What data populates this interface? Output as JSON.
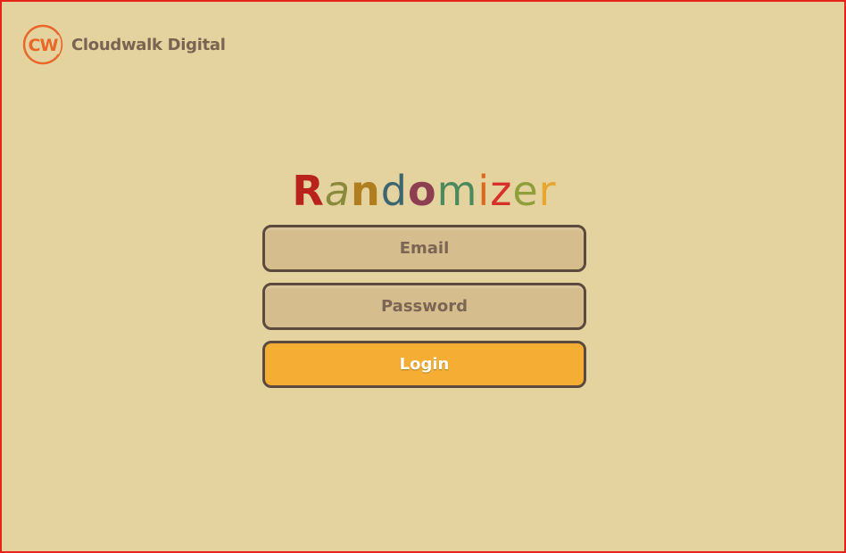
{
  "brand": {
    "name": "Cloudwalk Digital",
    "logo_icon": "cloudwalk-cw-logo-icon",
    "logo_text": "CW",
    "logo_color": "#e8672a"
  },
  "title": {
    "letters": [
      {
        "char": "R",
        "color": "#b8231c"
      },
      {
        "char": "a",
        "color": "#8a8a3c"
      },
      {
        "char": "n",
        "color": "#b07d1f"
      },
      {
        "char": "d",
        "color": "#3b6670"
      },
      {
        "char": "o",
        "color": "#8d3f52"
      },
      {
        "char": "m",
        "color": "#4c8a5e"
      },
      {
        "char": "i",
        "color": "#d9691f"
      },
      {
        "char": "z",
        "color": "#d8302b"
      },
      {
        "char": "e",
        "color": "#8fa03b"
      },
      {
        "char": "r",
        "color": "#e8a530"
      }
    ]
  },
  "form": {
    "email_placeholder": "Email",
    "password_placeholder": "Password",
    "login_label": "Login"
  },
  "colors": {
    "background": "#e4d39f",
    "field_fill": "#d5bd8e",
    "field_border": "#5b4a3d",
    "button_fill": "#f5ae33",
    "frame_border": "#e8231a"
  }
}
